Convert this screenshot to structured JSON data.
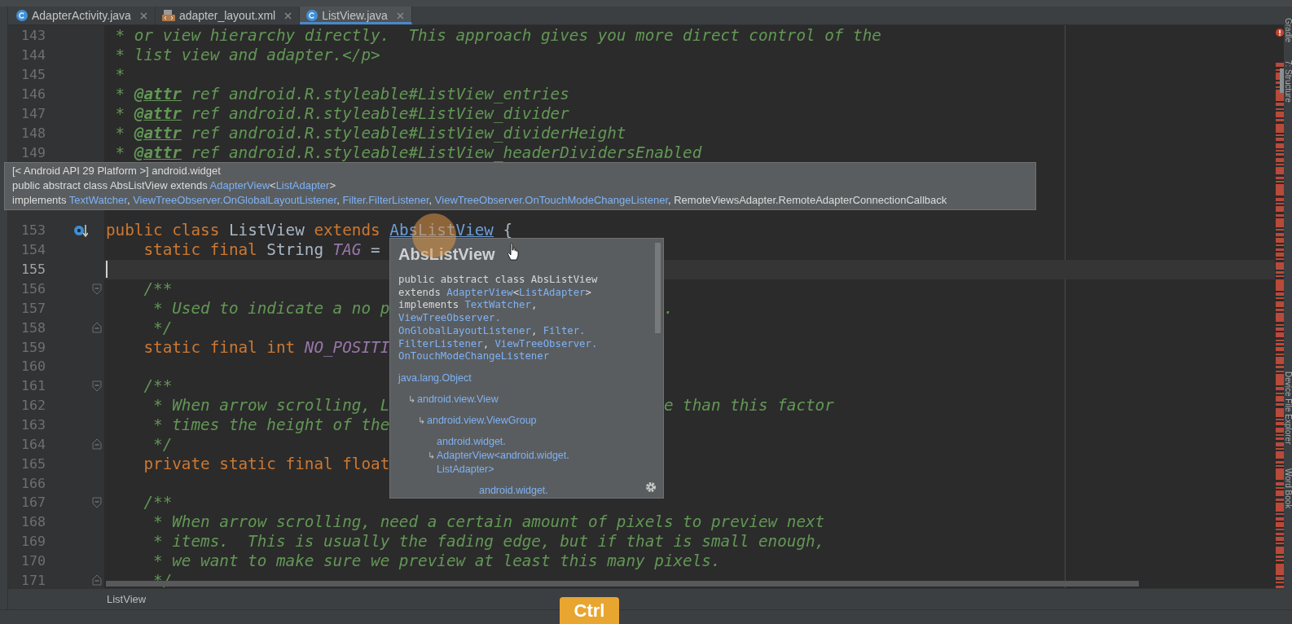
{
  "tabs": [
    {
      "label": "AdapterActivity.java",
      "kind": "class",
      "selected": false
    },
    {
      "label": "adapter_layout.xml",
      "kind": "xml",
      "selected": false
    },
    {
      "label": "ListView.java",
      "kind": "class",
      "selected": true
    }
  ],
  "right_tool_windows": [
    "Gradle",
    "7: Structure",
    "Device File Explorer",
    "Word Book"
  ],
  "editor": {
    "rows": [
      {
        "kind": "line",
        "number": "143",
        "current": false,
        "tokens": [
          {
            "text": " * or view hierarchy directly.  This approach gives you more direct control of the",
            "kind": "comment"
          }
        ]
      },
      {
        "kind": "line",
        "number": "144",
        "current": false,
        "tokens": [
          {
            "text": " * list view and adapter.</p>",
            "kind": "comment"
          }
        ]
      },
      {
        "kind": "line",
        "number": "145",
        "current": false,
        "tokens": [
          {
            "text": " *",
            "kind": "comment"
          }
        ]
      },
      {
        "kind": "line",
        "number": "146",
        "current": false,
        "tokens": [
          {
            "text": " * ",
            "kind": "comment"
          },
          {
            "text": "@attr",
            "kind": "doctag"
          },
          {
            "text": " ref android.R.styleable#ListView_entries",
            "kind": "comment"
          }
        ]
      },
      {
        "kind": "line",
        "number": "147",
        "current": false,
        "tokens": [
          {
            "text": " * ",
            "kind": "comment"
          },
          {
            "text": "@attr",
            "kind": "doctag"
          },
          {
            "text": " ref android.R.styleable#ListView_divider",
            "kind": "comment"
          }
        ]
      },
      {
        "kind": "line",
        "number": "148",
        "current": false,
        "tokens": [
          {
            "text": " * ",
            "kind": "comment"
          },
          {
            "text": "@attr",
            "kind": "doctag"
          },
          {
            "text": " ref android.R.styleable#ListView_dividerHeight",
            "kind": "comment"
          }
        ]
      },
      {
        "kind": "line",
        "number": "149",
        "current": false,
        "tokens": [
          {
            "text": " * ",
            "kind": "comment"
          },
          {
            "text": "@attr",
            "kind": "doctag"
          },
          {
            "text": " ref android.R.styleable#ListView_headerDividersEnabled",
            "kind": "comment"
          }
        ]
      },
      {
        "kind": "popup",
        "lines": [
          [
            {
              "text": "[< Android API 29 Platform >] android.widget",
              "kind": "text"
            }
          ],
          [
            {
              "text": "public abstract class AbsListView extends ",
              "kind": "text"
            },
            {
              "text": "AdapterView",
              "kind": "link"
            },
            {
              "text": "<",
              "kind": "text"
            },
            {
              "text": "ListAdapter",
              "kind": "link"
            },
            {
              "text": ">",
              "kind": "text"
            }
          ],
          [
            {
              "text": "implements ",
              "kind": "text"
            },
            {
              "text": "TextWatcher",
              "kind": "link"
            },
            {
              "text": ", ",
              "kind": "text"
            },
            {
              "text": "ViewTreeObserver.OnGlobalLayoutListener",
              "kind": "link"
            },
            {
              "text": ", ",
              "kind": "text"
            },
            {
              "text": "Filter.FilterListener",
              "kind": "link"
            },
            {
              "text": ", ",
              "kind": "text"
            },
            {
              "text": "ViewTreeObserver.OnTouchModeChangeListener",
              "kind": "link"
            },
            {
              "text": ", RemoteViewsAdapter.RemoteAdapterConnectionCallback",
              "kind": "text"
            }
          ]
        ]
      },
      {
        "kind": "line",
        "number": "153",
        "current": false,
        "gutter": {
          "kind": "implements"
        },
        "tokens": [
          {
            "text": "public class ",
            "kind": "keyword"
          },
          {
            "text": "ListView ",
            "kind": "plain"
          },
          {
            "text": "extends ",
            "kind": "keyword"
          },
          {
            "text": "AbsListView",
            "kind": "link"
          },
          {
            "text": " {",
            "kind": "plain"
          }
        ]
      },
      {
        "kind": "line",
        "number": "154",
        "current": false,
        "tokens": [
          {
            "text": "    static final ",
            "kind": "keyword"
          },
          {
            "text": "String ",
            "kind": "plain"
          },
          {
            "text": "TAG",
            "kind": "const"
          },
          {
            "text": " =",
            "kind": "plain"
          }
        ]
      },
      {
        "kind": "line",
        "number": "155",
        "current": true
      },
      {
        "kind": "line",
        "number": "156",
        "current": false,
        "fold": {
          "kind": "start"
        },
        "tokens": [
          {
            "text": "    /**",
            "kind": "comment"
          }
        ]
      },
      {
        "kind": "line",
        "number": "157",
        "current": false,
        "tokens": [
          {
            "text": "     * Used to indicate a no p",
            "kind": "comment"
          }
        ],
        "after": [
          {
            "text": ".",
            "kind": "comment"
          }
        ]
      },
      {
        "kind": "line",
        "number": "158",
        "current": false,
        "fold": {
          "kind": "end"
        },
        "tokens": [
          {
            "text": "     */",
            "kind": "comment"
          }
        ]
      },
      {
        "kind": "line",
        "number": "159",
        "current": false,
        "tokens": [
          {
            "text": "    static final int ",
            "kind": "keyword"
          },
          {
            "text": "NO_POSITI",
            "kind": "const"
          }
        ]
      },
      {
        "kind": "line",
        "number": "160",
        "current": false
      },
      {
        "kind": "line",
        "number": "161",
        "current": false,
        "fold": {
          "kind": "start"
        },
        "tokens": [
          {
            "text": "    /**",
            "kind": "comment"
          }
        ]
      },
      {
        "kind": "line",
        "number": "162",
        "current": false,
        "tokens": [
          {
            "text": "     * When arrow scrolling, L",
            "kind": "comment"
          }
        ],
        "after": [
          {
            "text": "e than this factor",
            "kind": "comment"
          }
        ]
      },
      {
        "kind": "line",
        "number": "163",
        "current": false,
        "tokens": [
          {
            "text": "     * times the height of the",
            "kind": "comment"
          }
        ]
      },
      {
        "kind": "line",
        "number": "164",
        "current": false,
        "fold": {
          "kind": "end"
        },
        "tokens": [
          {
            "text": "     */",
            "kind": "comment"
          }
        ]
      },
      {
        "kind": "line",
        "number": "165",
        "current": false,
        "tokens": [
          {
            "text": "    private static final float",
            "kind": "keyword"
          }
        ]
      },
      {
        "kind": "line",
        "number": "166",
        "current": false
      },
      {
        "kind": "line",
        "number": "167",
        "current": false,
        "fold": {
          "kind": "start"
        },
        "tokens": [
          {
            "text": "    /**",
            "kind": "comment"
          }
        ]
      },
      {
        "kind": "line",
        "number": "168",
        "current": false,
        "tokens": [
          {
            "text": "     * When arrow scrolling, need a certain amount of pixels to preview next",
            "kind": "comment"
          }
        ]
      },
      {
        "kind": "line",
        "number": "169",
        "current": false,
        "tokens": [
          {
            "text": "     * items.  This is usually the fading edge, but if that is small enough,",
            "kind": "comment"
          }
        ]
      },
      {
        "kind": "line",
        "number": "170",
        "current": false,
        "tokens": [
          {
            "text": "     * we want to make sure we preview at least this many pixels.",
            "kind": "comment"
          }
        ]
      },
      {
        "kind": "line",
        "number": "171",
        "current": false,
        "fold": {
          "kind": "end"
        },
        "tokens": [
          {
            "text": "     */",
            "kind": "comment"
          }
        ]
      }
    ],
    "doc_popup": {
      "title": "AbsListView",
      "signature": [
        [
          {
            "text": "public abstract class AbsListView",
            "kind": "text"
          }
        ],
        [
          {
            "text": "extends ",
            "kind": "text"
          },
          {
            "text": "AdapterView",
            "kind": "link"
          },
          {
            "text": "<",
            "kind": "text"
          },
          {
            "text": "ListAdapter",
            "kind": "link"
          },
          {
            "text": ">",
            "kind": "text"
          }
        ],
        [
          {
            "text": "implements ",
            "kind": "text"
          },
          {
            "text": "TextWatcher",
            "kind": "link"
          },
          {
            "text": ",",
            "kind": "text"
          }
        ],
        [
          {
            "text": "ViewTreeObserver.",
            "kind": "link"
          }
        ],
        [
          {
            "text": "OnGlobalLayoutListener",
            "kind": "link"
          },
          {
            "text": ", ",
            "kind": "text"
          },
          {
            "text": "Filter.",
            "kind": "link"
          }
        ],
        [
          {
            "text": "FilterListener",
            "kind": "link"
          },
          {
            "text": ", ",
            "kind": "text"
          },
          {
            "text": "ViewTreeObserver.",
            "kind": "link"
          }
        ],
        [
          {
            "text": "OnTouchModeChangeListener",
            "kind": "link"
          }
        ]
      ],
      "hierarchy": [
        {
          "lines": [
            "java.lang.Object"
          ],
          "children": [
            {
              "arrow": "↳",
              "lines": [
                "android.view.View"
              ],
              "children": [
                {
                  "arrow": "↳",
                  "lines": [
                    "android.view.ViewGroup"
                  ],
                  "children": [
                    {
                      "arrow": "↳",
                      "lines": [
                        "android.widget.",
                        "AdapterView<android.widget.",
                        "ListAdapter>"
                      ],
                      "children": [
                        {
                          "lines": [
                            "android.widget."
                          ]
                        }
                      ]
                    }
                  ]
                }
              ]
            }
          ]
        }
      ]
    }
  },
  "breadcrumb": "ListView",
  "key_overlay": "Ctrl"
}
